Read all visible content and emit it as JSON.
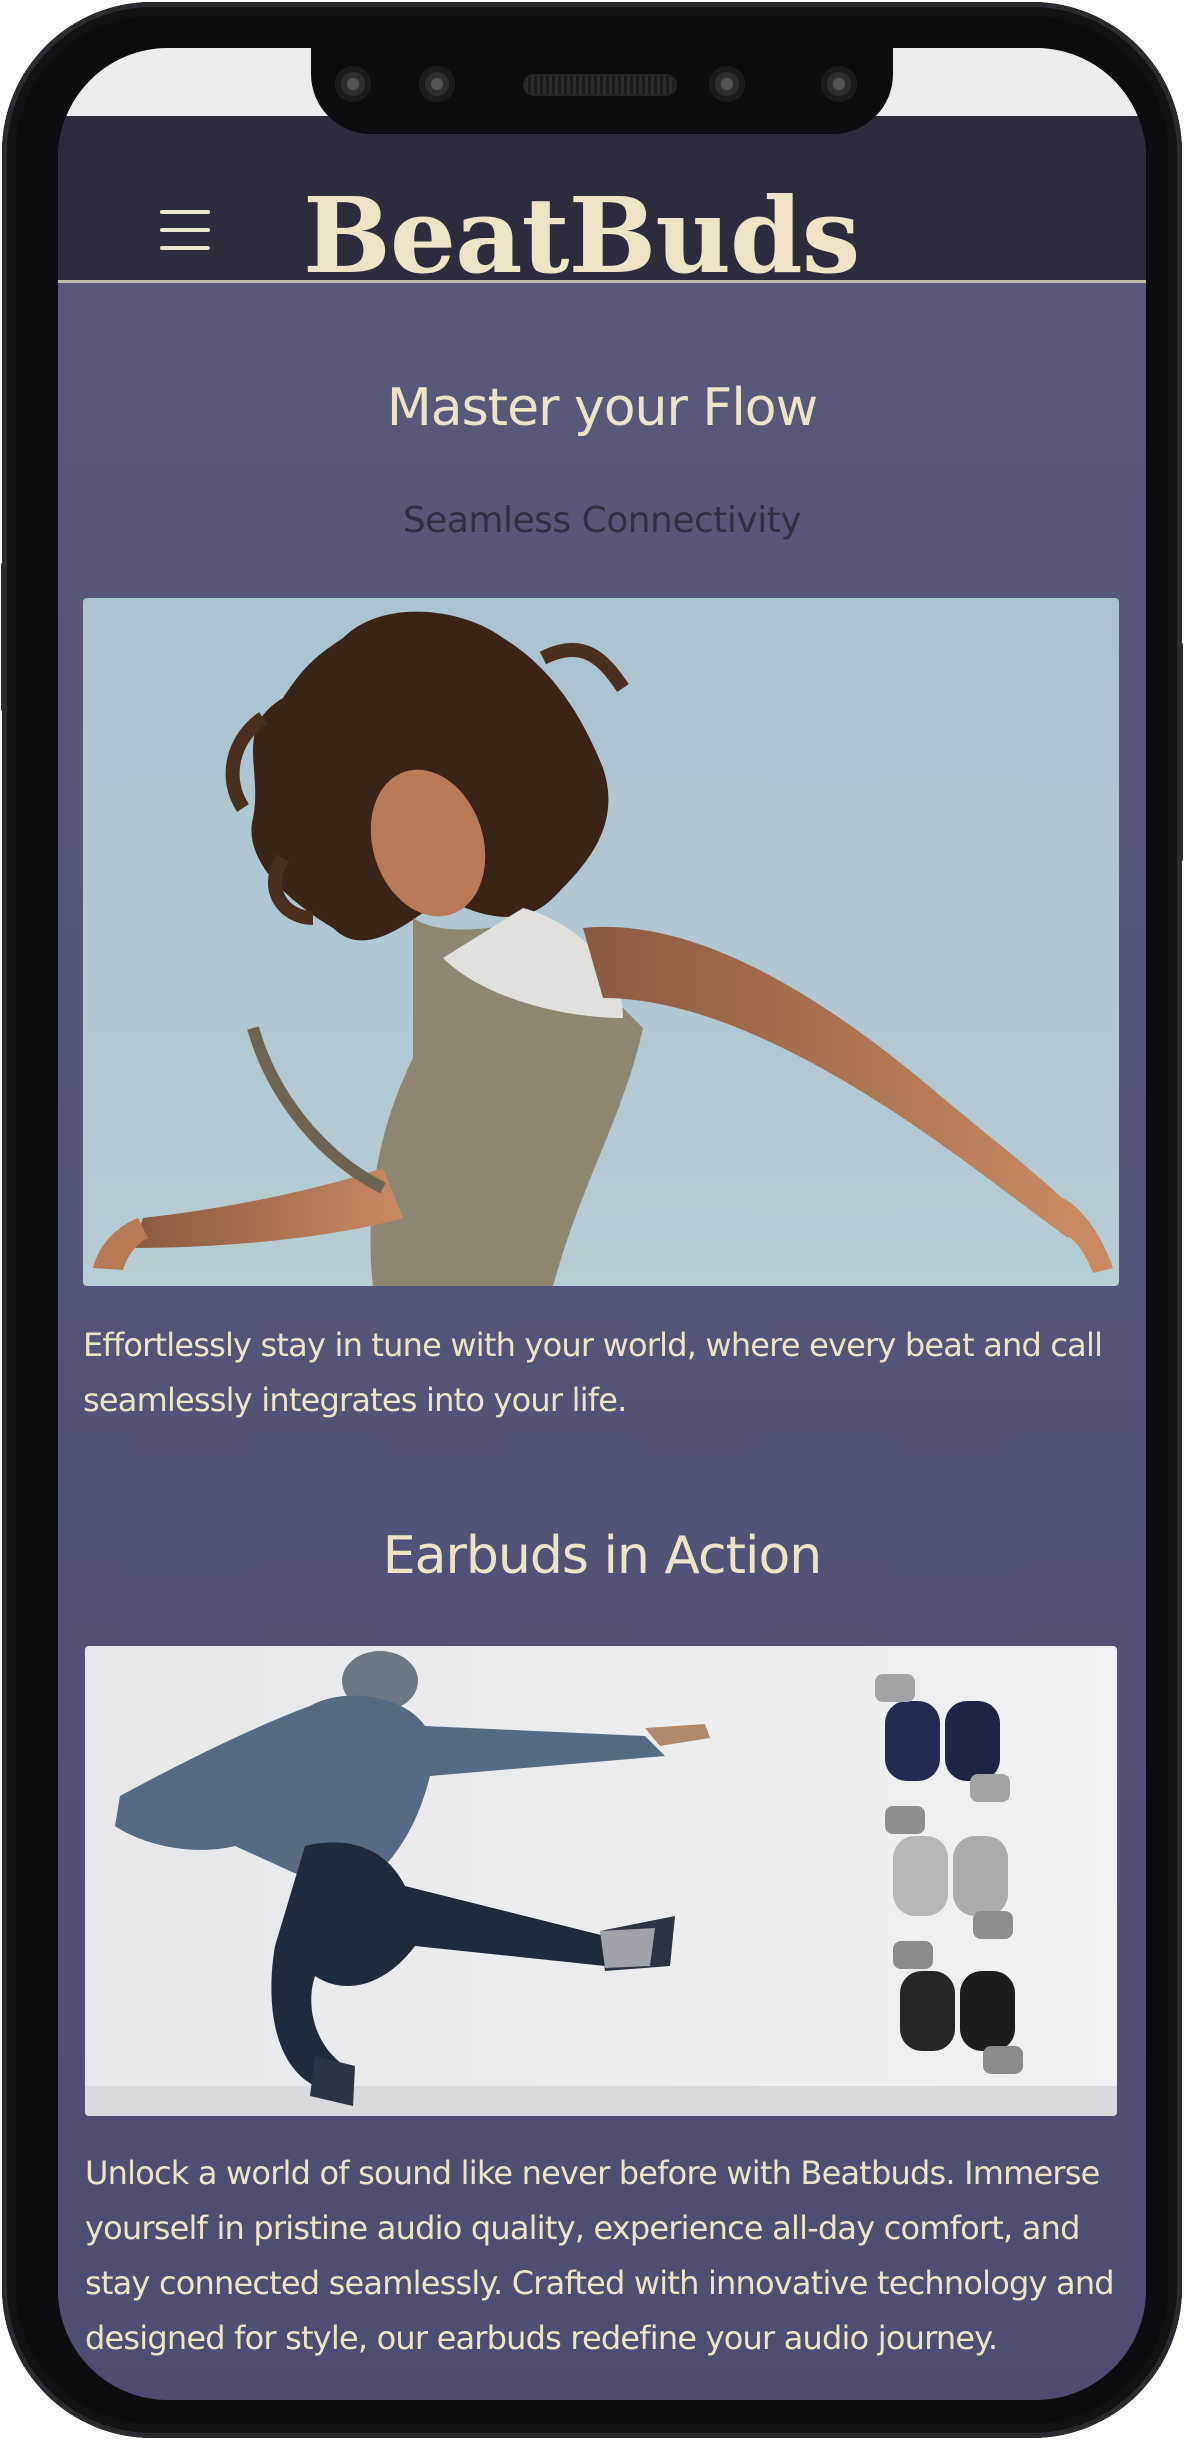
{
  "header": {
    "menu_icon": "hamburger-menu-icon",
    "logo_text": "BeatBuds"
  },
  "hero": {
    "title": "Master your Flow",
    "subtitle": "Seamless Connectivity",
    "description": "Effortlessly stay in tune with your world, where every beat and call seamlessly integrates into your life."
  },
  "action": {
    "title": "Earbuds in Action",
    "description": "Unlock a world of sound like never before with Beatbuds. Immerse yourself in pristine audio quality, experience all-day comfort, and stay connected seamlessly. Crafted with innovative technology and designed for style, our earbuds redefine your audio journey."
  },
  "colors": {
    "background": "#56567a",
    "header": "#2c2c3c",
    "accent_text": "#ece4c4",
    "subtitle_text": "#2f3046"
  }
}
